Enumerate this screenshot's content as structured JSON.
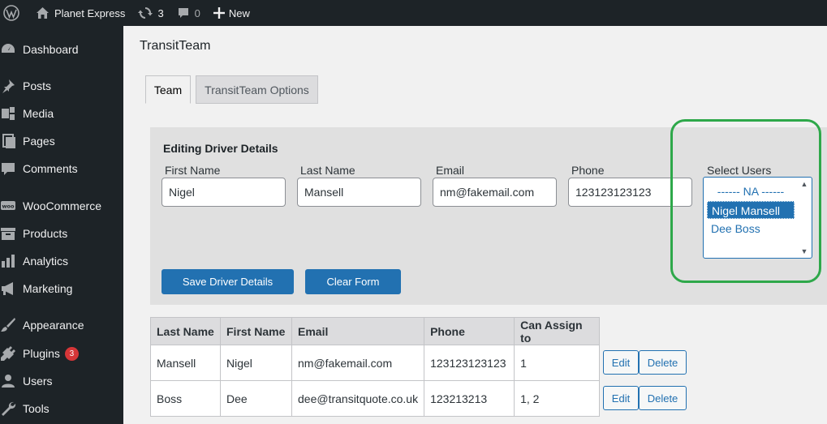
{
  "adminbar": {
    "site_name": "Planet Express",
    "updates_count": "3",
    "comments_count": "0",
    "new_label": "New"
  },
  "sidebar": {
    "items": [
      {
        "label": "Dashboard",
        "icon": "dashboard-icon"
      },
      {
        "label": "Posts",
        "icon": "pin-icon"
      },
      {
        "label": "Media",
        "icon": "media-icon"
      },
      {
        "label": "Pages",
        "icon": "pages-icon"
      },
      {
        "label": "Comments",
        "icon": "comment-icon"
      },
      {
        "label": "WooCommerce",
        "icon": "woo-icon"
      },
      {
        "label": "Products",
        "icon": "archive-icon"
      },
      {
        "label": "Analytics",
        "icon": "bar-chart-icon"
      },
      {
        "label": "Marketing",
        "icon": "megaphone-icon"
      },
      {
        "label": "Appearance",
        "icon": "brush-icon"
      },
      {
        "label": "Plugins",
        "icon": "plug-icon",
        "badge": "3"
      },
      {
        "label": "Users",
        "icon": "user-icon"
      },
      {
        "label": "Tools",
        "icon": "wrench-icon"
      }
    ]
  },
  "page": {
    "title": "TransitTeam",
    "tabs": [
      "Team",
      "TransitTeam Options"
    ]
  },
  "form": {
    "heading": "Editing Driver Details",
    "first_name": {
      "label": "First Name",
      "value": "Nigel"
    },
    "last_name": {
      "label": "Last Name",
      "value": "Mansell"
    },
    "email": {
      "label": "Email",
      "value": "nm@fakemail.com"
    },
    "phone": {
      "label": "Phone",
      "value": "123123123123"
    },
    "select_users": {
      "label": "Select Users",
      "options": [
        "------ NA ------",
        "Nigel Mansell",
        "Dee Boss"
      ],
      "selected": "Nigel Mansell"
    },
    "save_label": "Save Driver Details",
    "clear_label": "Clear Form"
  },
  "table": {
    "headers": [
      "Last Name",
      "First Name",
      "Email",
      "Phone",
      "Can Assign to"
    ],
    "rows": [
      [
        "Mansell",
        "Nigel",
        "nm@fakemail.com",
        "123123123123",
        "1"
      ],
      [
        "Boss",
        "Dee",
        "dee@transitquote.co.uk",
        "123213213",
        "1, 2"
      ]
    ],
    "edit_label": "Edit",
    "delete_label": "Delete"
  },
  "colors": {
    "admin_dark": "#1d2327",
    "primary_blue": "#2271b1",
    "highlight_green": "#2ea84a",
    "badge_red": "#d63638"
  }
}
